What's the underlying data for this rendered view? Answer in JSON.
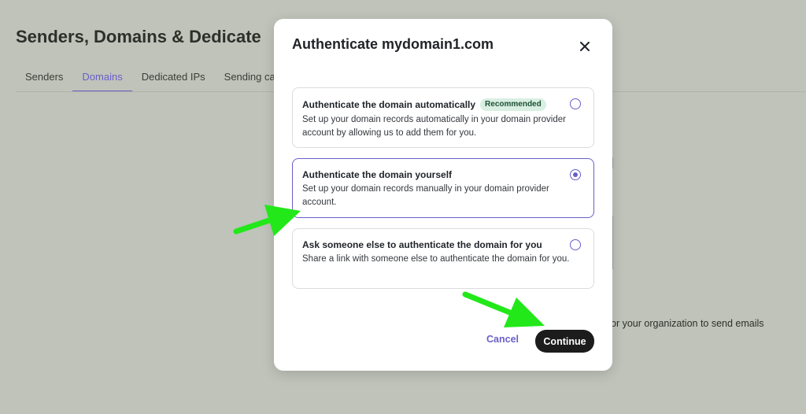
{
  "background": {
    "title": "Senders, Domains & Dedicate",
    "tabs": [
      {
        "label": "Senders",
        "active": false
      },
      {
        "label": "Domains",
        "active": true
      },
      {
        "label": "Dedicated IPs",
        "active": false
      },
      {
        "label": "Sending cade",
        "active": false
      }
    ],
    "fragment_text": "or your organization to send emails"
  },
  "modal": {
    "title": "Authenticate mydomain1.com",
    "options": [
      {
        "title": "Authenticate the domain automatically",
        "badge": "Recommended",
        "description": "Set up your domain records automatically in your domain provider account by allowing us to add them for you.",
        "selected": false
      },
      {
        "title": "Authenticate the domain yourself",
        "badge": "",
        "description": "Set up your domain records manually in your domain provider account.",
        "selected": true
      },
      {
        "title": "Ask someone else to authenticate the domain for you",
        "badge": "",
        "description": "Share a link with someone else to authenticate the domain for you.",
        "selected": false
      }
    ],
    "cancel_label": "Cancel",
    "continue_label": "Continue"
  },
  "colors": {
    "accent": "#6a5fc8",
    "overlay": "#bfc3ba",
    "annotation_arrow": "#22e81a",
    "primary_button": "#1c1c1c",
    "badge_bg": "#d8efe2"
  },
  "icons": {
    "close": "close-icon",
    "annotation": "arrow-annotation-icon"
  }
}
